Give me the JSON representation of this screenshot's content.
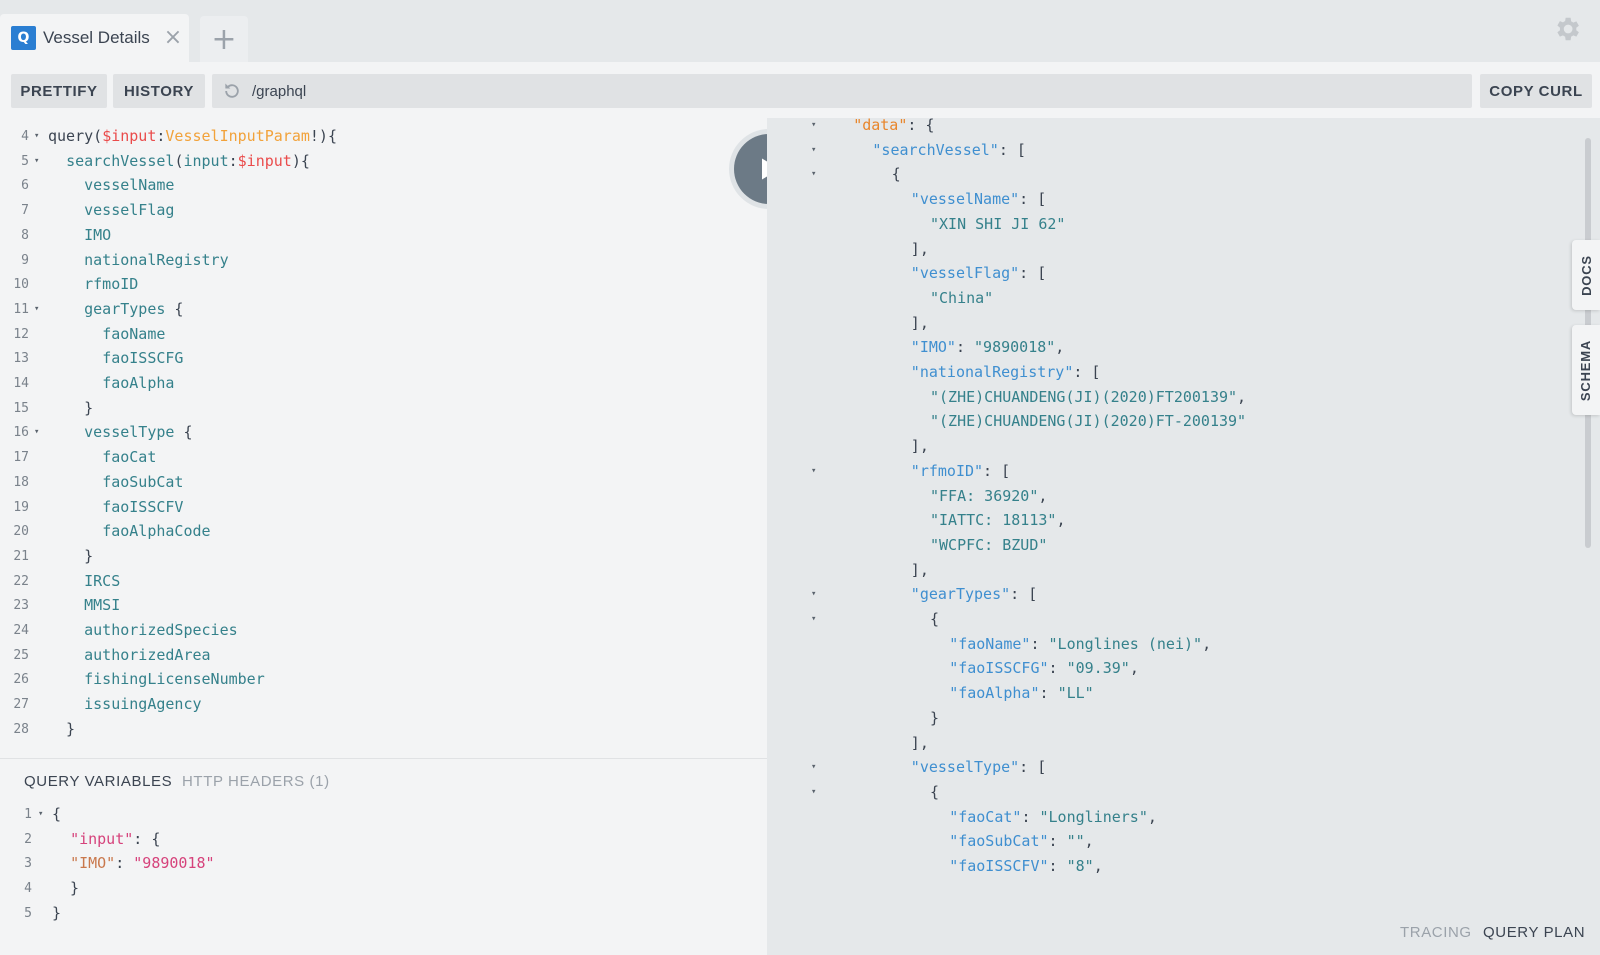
{
  "tab": {
    "badge": "Q",
    "title": "Vessel Details",
    "close_glyph": "×",
    "add_glyph": "+"
  },
  "toolbar": {
    "prettify": "PRETTIFY",
    "history": "HISTORY",
    "url": "/graphql",
    "copy_curl": "COPY CURL"
  },
  "editor_lines": [
    {
      "ln": "4",
      "fold": true,
      "parts": [
        [
          "kw",
          "query("
        ],
        [
          "var",
          "$input"
        ],
        [
          "pn",
          ":"
        ],
        [
          "type",
          "VesselInputParam"
        ],
        [
          "pn",
          "!){"
        ]
      ]
    },
    {
      "ln": "5",
      "fold": true,
      "parts": [
        [
          "pn",
          "  "
        ],
        [
          "fld",
          "searchVessel"
        ],
        [
          "pn",
          "("
        ],
        [
          "fld",
          "input"
        ],
        [
          "pn",
          ":"
        ],
        [
          "var",
          "$input"
        ],
        [
          "pn",
          "){"
        ]
      ]
    },
    {
      "ln": "6",
      "parts": [
        [
          "pn",
          "    "
        ],
        [
          "fld",
          "vesselName"
        ]
      ]
    },
    {
      "ln": "7",
      "parts": [
        [
          "pn",
          "    "
        ],
        [
          "fld",
          "vesselFlag"
        ]
      ]
    },
    {
      "ln": "8",
      "parts": [
        [
          "pn",
          "    "
        ],
        [
          "fld",
          "IMO"
        ]
      ]
    },
    {
      "ln": "9",
      "parts": [
        [
          "pn",
          "    "
        ],
        [
          "fld",
          "nationalRegistry"
        ]
      ]
    },
    {
      "ln": "10",
      "parts": [
        [
          "pn",
          "    "
        ],
        [
          "fld",
          "rfmoID"
        ]
      ]
    },
    {
      "ln": "11",
      "fold": true,
      "parts": [
        [
          "pn",
          "    "
        ],
        [
          "fld",
          "gearTypes"
        ],
        [
          "pn",
          " {"
        ]
      ]
    },
    {
      "ln": "12",
      "parts": [
        [
          "pn",
          "      "
        ],
        [
          "fld",
          "faoName"
        ]
      ]
    },
    {
      "ln": "13",
      "parts": [
        [
          "pn",
          "      "
        ],
        [
          "fld",
          "faoISSCFG"
        ]
      ]
    },
    {
      "ln": "14",
      "parts": [
        [
          "pn",
          "      "
        ],
        [
          "fld",
          "faoAlpha"
        ]
      ]
    },
    {
      "ln": "15",
      "parts": [
        [
          "pn",
          "    }"
        ]
      ]
    },
    {
      "ln": "16",
      "fold": true,
      "parts": [
        [
          "pn",
          "    "
        ],
        [
          "fld",
          "vesselType"
        ],
        [
          "pn",
          " {"
        ]
      ]
    },
    {
      "ln": "17",
      "parts": [
        [
          "pn",
          "      "
        ],
        [
          "fld",
          "faoCat"
        ]
      ]
    },
    {
      "ln": "18",
      "parts": [
        [
          "pn",
          "      "
        ],
        [
          "fld",
          "faoSubCat"
        ]
      ]
    },
    {
      "ln": "19",
      "parts": [
        [
          "pn",
          "      "
        ],
        [
          "fld",
          "faoISSCFV"
        ]
      ]
    },
    {
      "ln": "20",
      "parts": [
        [
          "pn",
          "      "
        ],
        [
          "fld",
          "faoAlphaCode"
        ]
      ]
    },
    {
      "ln": "21",
      "parts": [
        [
          "pn",
          "    }"
        ]
      ]
    },
    {
      "ln": "22",
      "parts": [
        [
          "pn",
          "    "
        ],
        [
          "fld",
          "IRCS"
        ]
      ]
    },
    {
      "ln": "23",
      "parts": [
        [
          "pn",
          "    "
        ],
        [
          "fld",
          "MMSI"
        ]
      ]
    },
    {
      "ln": "24",
      "parts": [
        [
          "pn",
          "    "
        ],
        [
          "fld",
          "authorizedSpecies"
        ]
      ]
    },
    {
      "ln": "25",
      "parts": [
        [
          "pn",
          "    "
        ],
        [
          "fld",
          "authorizedArea"
        ]
      ]
    },
    {
      "ln": "26",
      "parts": [
        [
          "pn",
          "    "
        ],
        [
          "fld",
          "fishingLicenseNumber"
        ]
      ]
    },
    {
      "ln": "27",
      "parts": [
        [
          "pn",
          "    "
        ],
        [
          "fld",
          "issuingAgency"
        ]
      ]
    },
    {
      "ln": "28",
      "parts": [
        [
          "pn",
          "  }"
        ]
      ]
    }
  ],
  "vars_panel": {
    "tab_variables": "QUERY VARIABLES",
    "tab_headers": "HTTP HEADERS (1)",
    "lines": [
      {
        "ln": "1",
        "fold": true,
        "parts": [
          [
            "pn",
            "{"
          ]
        ]
      },
      {
        "ln": "2",
        "parts": [
          [
            "pn",
            "  "
          ],
          [
            "key-red",
            "\"input\""
          ],
          [
            "pn",
            ": {"
          ]
        ]
      },
      {
        "ln": "3",
        "parts": [
          [
            "pn",
            "  "
          ],
          [
            "key-orange",
            "\"IMO\""
          ],
          [
            "pn",
            ": "
          ],
          [
            "str-pink",
            "\"9890018\""
          ]
        ]
      },
      {
        "ln": "4",
        "parts": [
          [
            "pn",
            "  }"
          ]
        ]
      },
      {
        "ln": "5",
        "parts": [
          [
            "pn",
            "}"
          ]
        ]
      }
    ]
  },
  "result_lines": [
    {
      "fold": true,
      "indent": 2,
      "parts": [
        [
          "rkey-top",
          "\"data\""
        ],
        [
          "pn",
          ": {"
        ]
      ]
    },
    {
      "fold": true,
      "indent": 4,
      "parts": [
        [
          "rkey",
          "\"searchVessel\""
        ],
        [
          "pn",
          ": ["
        ]
      ]
    },
    {
      "fold": true,
      "indent": 6,
      "parts": [
        [
          "pn",
          "{"
        ]
      ]
    },
    {
      "indent": 8,
      "parts": [
        [
          "rkey",
          "\"vesselName\""
        ],
        [
          "pn",
          ": ["
        ]
      ]
    },
    {
      "indent": 10,
      "parts": [
        [
          "rstr",
          "\"XIN SHI JI 62\""
        ]
      ]
    },
    {
      "indent": 8,
      "parts": [
        [
          "pn",
          "],"
        ]
      ]
    },
    {
      "indent": 8,
      "parts": [
        [
          "rkey",
          "\"vesselFlag\""
        ],
        [
          "pn",
          ": ["
        ]
      ]
    },
    {
      "indent": 10,
      "parts": [
        [
          "rstr",
          "\"China\""
        ]
      ]
    },
    {
      "indent": 8,
      "parts": [
        [
          "pn",
          "],"
        ]
      ]
    },
    {
      "indent": 8,
      "parts": [
        [
          "rkey",
          "\"IMO\""
        ],
        [
          "pn",
          ": "
        ],
        [
          "rstr",
          "\"9890018\""
        ],
        [
          "pn",
          ","
        ]
      ]
    },
    {
      "indent": 8,
      "parts": [
        [
          "rkey",
          "\"nationalRegistry\""
        ],
        [
          "pn",
          ": ["
        ]
      ]
    },
    {
      "indent": 10,
      "parts": [
        [
          "rstr",
          "\"(ZHE)CHUANDENG(JI)(2020)FT200139\""
        ],
        [
          "pn",
          ","
        ]
      ]
    },
    {
      "indent": 10,
      "parts": [
        [
          "rstr",
          "\"(ZHE)CHUANDENG(JI)(2020)FT-200139\""
        ]
      ]
    },
    {
      "indent": 8,
      "parts": [
        [
          "pn",
          "],"
        ]
      ]
    },
    {
      "fold": true,
      "indent": 8,
      "parts": [
        [
          "rkey",
          "\"rfmoID\""
        ],
        [
          "pn",
          ": ["
        ]
      ]
    },
    {
      "indent": 10,
      "parts": [
        [
          "rstr",
          "\"FFA: 36920\""
        ],
        [
          "pn",
          ","
        ]
      ]
    },
    {
      "indent": 10,
      "parts": [
        [
          "rstr",
          "\"IATTC: 18113\""
        ],
        [
          "pn",
          ","
        ]
      ]
    },
    {
      "indent": 10,
      "parts": [
        [
          "rstr",
          "\"WCPFC: BZUD\""
        ]
      ]
    },
    {
      "indent": 8,
      "parts": [
        [
          "pn",
          "],"
        ]
      ]
    },
    {
      "fold": true,
      "indent": 8,
      "parts": [
        [
          "rkey",
          "\"gearTypes\""
        ],
        [
          "pn",
          ": ["
        ]
      ]
    },
    {
      "fold": true,
      "indent": 10,
      "parts": [
        [
          "pn",
          "{"
        ]
      ]
    },
    {
      "indent": 12,
      "parts": [
        [
          "rkey",
          "\"faoName\""
        ],
        [
          "pn",
          ": "
        ],
        [
          "rstr",
          "\"Longlines (nei)\""
        ],
        [
          "pn",
          ","
        ]
      ]
    },
    {
      "indent": 12,
      "parts": [
        [
          "rkey",
          "\"faoISSCFG\""
        ],
        [
          "pn",
          ": "
        ],
        [
          "rstr",
          "\"09.39\""
        ],
        [
          "pn",
          ","
        ]
      ]
    },
    {
      "indent": 12,
      "parts": [
        [
          "rkey",
          "\"faoAlpha\""
        ],
        [
          "pn",
          ": "
        ],
        [
          "rstr",
          "\"LL\""
        ]
      ]
    },
    {
      "indent": 10,
      "parts": [
        [
          "pn",
          "}"
        ]
      ]
    },
    {
      "indent": 8,
      "parts": [
        [
          "pn",
          "],"
        ]
      ]
    },
    {
      "fold": true,
      "indent": 8,
      "parts": [
        [
          "rkey",
          "\"vesselType\""
        ],
        [
          "pn",
          ": ["
        ]
      ]
    },
    {
      "fold": true,
      "indent": 10,
      "parts": [
        [
          "pn",
          "{"
        ]
      ]
    },
    {
      "indent": 12,
      "parts": [
        [
          "rkey",
          "\"faoCat\""
        ],
        [
          "pn",
          ": "
        ],
        [
          "rstr",
          "\"Longliners\""
        ],
        [
          "pn",
          ","
        ]
      ]
    },
    {
      "indent": 12,
      "parts": [
        [
          "rkey",
          "\"faoSubCat\""
        ],
        [
          "pn",
          ": "
        ],
        [
          "rstr",
          "\"\""
        ],
        [
          "pn",
          ","
        ]
      ]
    },
    {
      "indent": 12,
      "parts": [
        [
          "rkey",
          "\"faoISSCFV\""
        ],
        [
          "pn",
          ": "
        ],
        [
          "rstr",
          "\"8\""
        ],
        [
          "pn",
          ","
        ]
      ]
    }
  ],
  "side_tabs": {
    "docs": "DOCS",
    "schema": "SCHEMA"
  },
  "footer": {
    "tracing": "TRACING",
    "query_plan": "QUERY PLAN"
  },
  "icons": {
    "gear": "gear-icon",
    "refresh": "refresh-icon",
    "play": "play-icon",
    "fold": "▾"
  },
  "colors": {
    "badge": "#2a7ed2",
    "play": "#6c7a86"
  }
}
